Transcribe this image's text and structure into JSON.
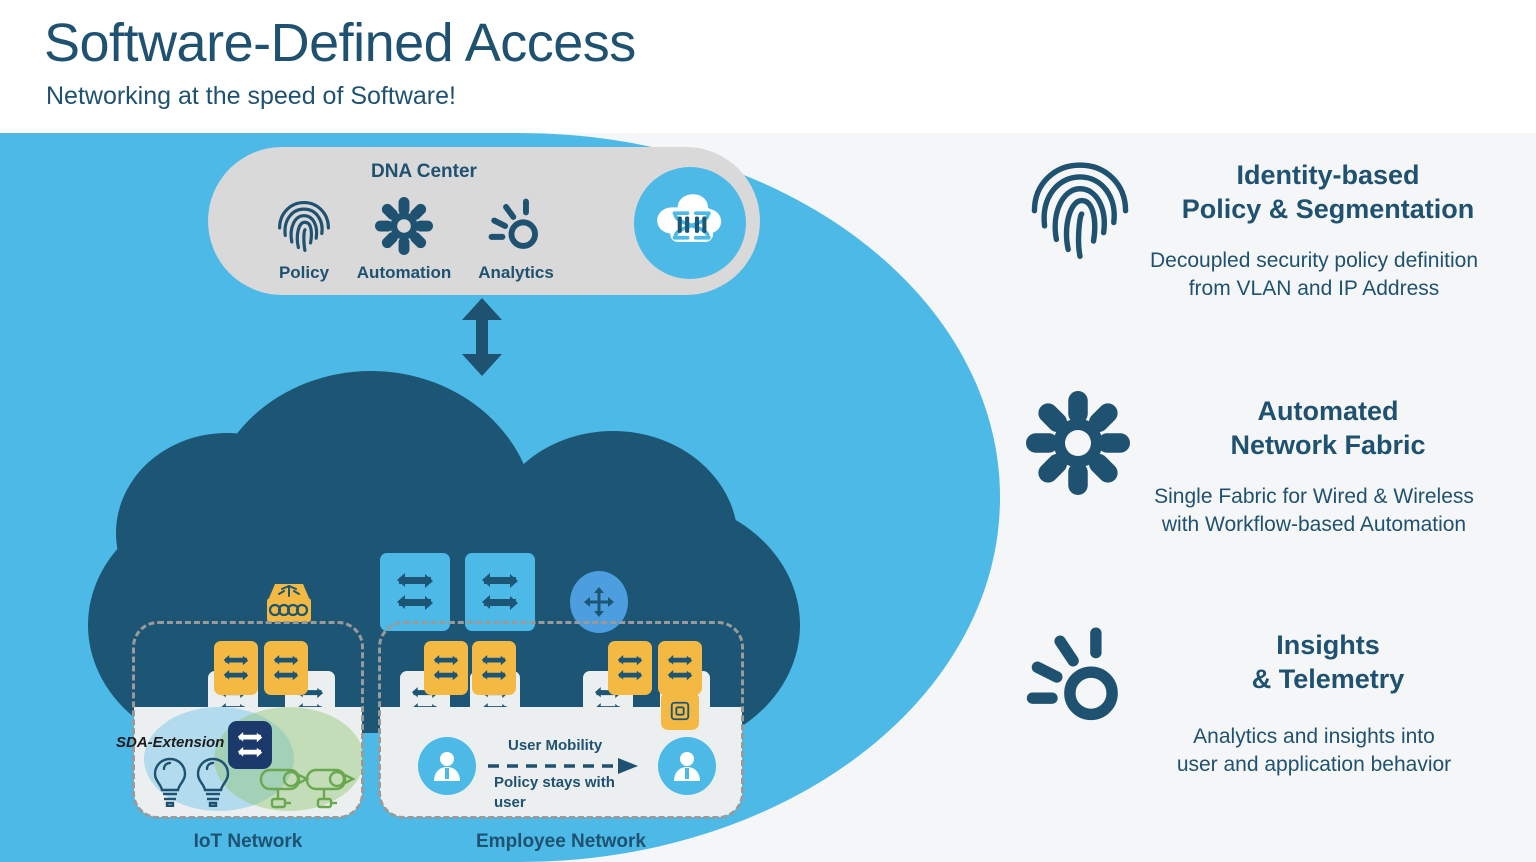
{
  "header": {
    "title": "Software-Defined Access",
    "subtitle": "Networking at the speed of Software!"
  },
  "colors": {
    "brand_blue": "#4cb9e7",
    "dark_blue": "#1f5170",
    "cloud_navy": "#1d5574",
    "orange": "#f4b942",
    "panel_gray": "#d9d9d9",
    "page_bg": "#f5f6f7"
  },
  "dna_center": {
    "title": "DNA Center",
    "items": [
      {
        "label": "Policy",
        "icon": "fingerprint-icon"
      },
      {
        "label": "Automation",
        "icon": "gear-icon"
      },
      {
        "label": "Analytics",
        "icon": "insights-sun-icon"
      }
    ],
    "logo_icon": "dna-cloud-logo-icon"
  },
  "fabric": {
    "uplink_arrow_icon": "bidirectional-arrow-icon",
    "wlc_icon": "wireless-controller-icon",
    "router_icon": "router-icon",
    "upper_switches": [
      "switch-icon",
      "switch-icon"
    ],
    "mid_switches": [
      "switch-icon",
      "switch-icon",
      "switch-icon",
      "switch-icon",
      "switch-icon",
      "switch-icon"
    ]
  },
  "zones": [
    {
      "id": "iot",
      "label": "IoT Network",
      "edge_switches": [
        "switch-icon",
        "switch-icon"
      ],
      "extension_label": "SDA-Extension",
      "extension_switch_icon": "switch-icon",
      "endpoints": [
        "lightbulb-icon",
        "lightbulb-icon",
        "camera-icon",
        "camera-icon"
      ]
    },
    {
      "id": "employee",
      "label": "Employee Network",
      "edge_switches": [
        "switch-icon",
        "switch-icon",
        "switch-icon",
        "switch-icon"
      ],
      "access_point_icon": "access-point-icon",
      "mobility_label": "User Mobility",
      "policy_label": "Policy stays with user",
      "mobility_arrow_icon": "dashed-arrow-right-icon",
      "avatars": [
        "user-avatar-icon",
        "user-avatar-icon"
      ]
    }
  ],
  "features": [
    {
      "icon": "fingerprint-icon",
      "title": "Identity-based\nPolicy & Segmentation",
      "title_line1": "Identity-based",
      "title_line2": "Policy & Segmentation",
      "desc_line1": "Decoupled security policy definition",
      "desc_line2": "from VLAN and IP Address"
    },
    {
      "icon": "gear-icon",
      "title": "Automated\nNetwork Fabric",
      "title_line1": "Automated",
      "title_line2": "Network Fabric",
      "desc_line1": "Single Fabric for Wired & Wireless",
      "desc_line2": "with Workflow-based Automation"
    },
    {
      "icon": "insights-sun-icon",
      "title": "Insights\n& Telemetry",
      "title_line1": "Insights",
      "title_line2": "& Telemetry",
      "desc_line1": "Analytics and insights into",
      "desc_line2": "user and application behavior"
    }
  ]
}
